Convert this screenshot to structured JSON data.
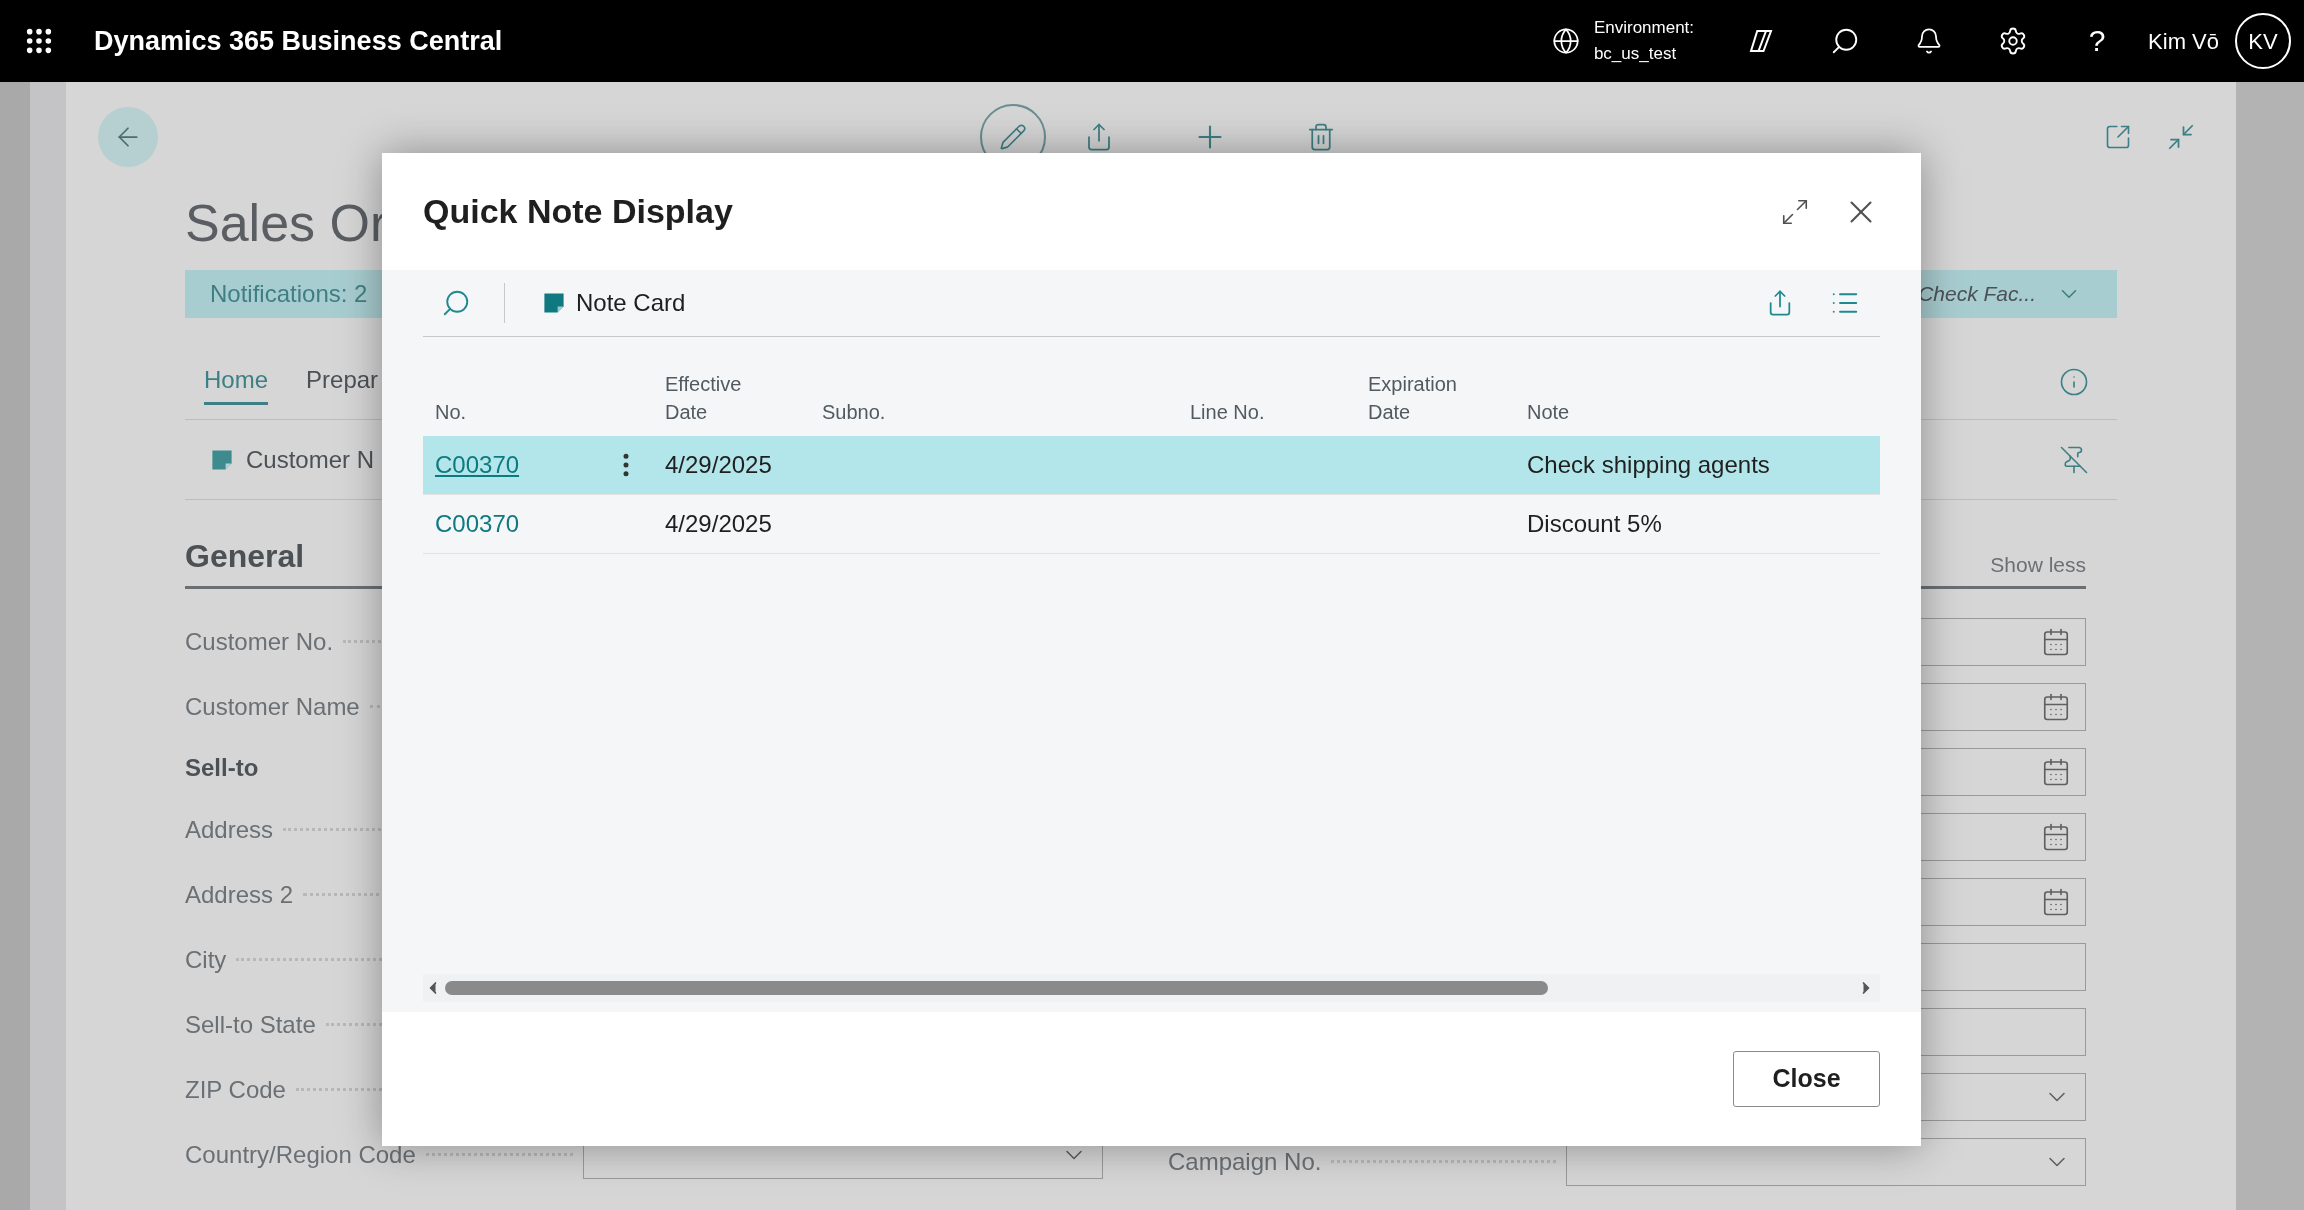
{
  "app_bar": {
    "title": "Dynamics 365 Business Central",
    "environment_label": "Environment:",
    "environment": "bc_us_test",
    "help": "?",
    "user": "Kim Vō",
    "initials": "KV"
  },
  "page": {
    "title": "Sales Or",
    "notifications": "Notifications: 2",
    "notification_message": "Check Fac...",
    "tabs": [
      {
        "label": "Home",
        "selected": true
      },
      {
        "label": "Prepar",
        "selected": false
      }
    ],
    "action": "Customer N",
    "section": "General",
    "show_less": "Show less",
    "left_fields": [
      {
        "label": "Customer No.",
        "kind": "field"
      },
      {
        "label": "Customer Name",
        "kind": "field"
      },
      {
        "label": "Sell-to",
        "kind": "group"
      },
      {
        "label": "Address",
        "kind": "field"
      },
      {
        "label": "Address 2",
        "kind": "field"
      },
      {
        "label": "City",
        "kind": "field"
      },
      {
        "label": "Sell-to State",
        "kind": "field"
      },
      {
        "label": "ZIP Code",
        "kind": "field"
      },
      {
        "label": "Country/Region Code",
        "kind": "dropdown"
      }
    ],
    "right_fields": [
      {
        "kind": "date"
      },
      {
        "kind": "date"
      },
      {
        "kind": "date"
      },
      {
        "kind": "date"
      },
      {
        "kind": "date"
      },
      {
        "kind": "text"
      },
      {
        "kind": "text"
      },
      {
        "kind": "dropdown"
      },
      {
        "label": "Campaign No.",
        "kind": "dropdown"
      }
    ]
  },
  "dialog": {
    "title": "Quick Note Display",
    "action": "Note Card",
    "columns": [
      "No.",
      "Effective Date",
      "Subno.",
      "Line No.",
      "Expiration Date",
      "Note"
    ],
    "rows": [
      {
        "no": "C00370",
        "effective_date": "4/29/2025",
        "note": "Check shipping agents",
        "selected": true
      },
      {
        "no": "C00370",
        "effective_date": "4/29/2025",
        "note": "Discount 5%",
        "selected": false
      }
    ],
    "close": "Close"
  }
}
